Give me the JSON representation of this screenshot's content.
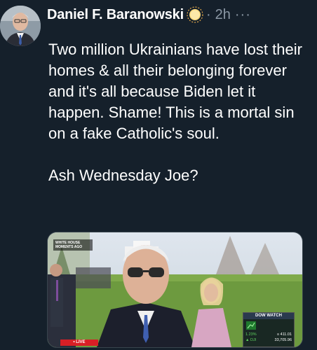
{
  "tweet": {
    "author_name": "Daniel F. Baranowski",
    "author_emoji": "sun-emoji",
    "separator": "·",
    "time": "2h",
    "more": "···",
    "paragraphs": [
      "Two million Ukrainians have lost their homes & all their belonging forever and it's all because Biden let it happen. Shame! This is a mortal sin on a fake Catholic's soul.",
      "Ash Wednesday Joe?"
    ]
  },
  "media": {
    "overlay_lines": [
      "WHITE HOUSE",
      "MOMENTS AGO"
    ],
    "live_label": "• LIVE",
    "dow": {
      "title": "DOW WATCH",
      "row1": {
        "left": "1.23%",
        "right": "≡ 411.01"
      },
      "row2": {
        "left": "▲ DJI",
        "right": "33,705.96"
      }
    }
  },
  "colors": {
    "background": "#15202b",
    "text": "#ffffff",
    "secondary": "#8b98a5",
    "border": "#38444d"
  }
}
